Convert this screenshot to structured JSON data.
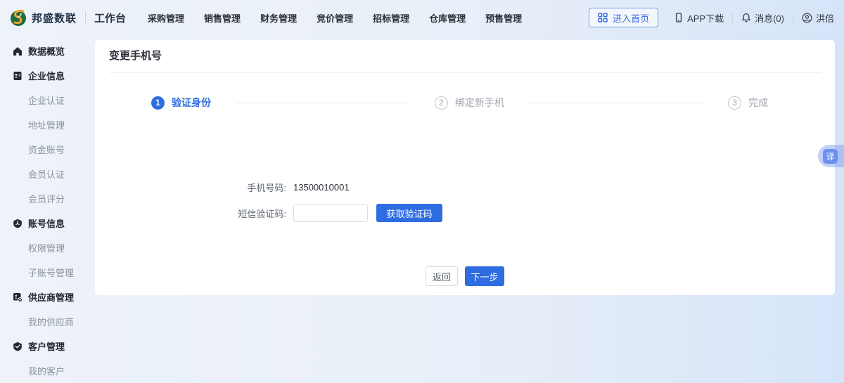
{
  "topbar": {
    "brand": "邦盛数联",
    "workspace": "工作台",
    "menu": [
      "采购管理",
      "销售管理",
      "财务管理",
      "竞价管理",
      "招标管理",
      "仓库管理",
      "预售管理"
    ],
    "enter_home": "进入首页",
    "app_download": "APP下载",
    "messages": "消息(0)",
    "username": "洪倍"
  },
  "sidebar": {
    "groups": [
      {
        "label": "数据概览",
        "icon": "home-icon",
        "children": []
      },
      {
        "label": "企业信息",
        "icon": "company-icon",
        "children": [
          "企业认证",
          "地址管理",
          "资金账号",
          "会员认证",
          "会员评分"
        ]
      },
      {
        "label": "账号信息",
        "icon": "account-icon",
        "children": [
          "权限管理",
          "子账号管理"
        ]
      },
      {
        "label": "供应商管理",
        "icon": "supplier-icon",
        "children": [
          "我的供应商"
        ]
      },
      {
        "label": "客户管理",
        "icon": "customer-icon",
        "children": [
          "我的客户"
        ]
      }
    ]
  },
  "main": {
    "title": "变更手机号",
    "steps": [
      {
        "num": "1",
        "label": "验证身份",
        "state": "active"
      },
      {
        "num": "2",
        "label": "绑定新手机",
        "state": "idle"
      },
      {
        "num": "3",
        "label": "完成",
        "state": "idle"
      }
    ],
    "form": {
      "phone_label": "手机号码:",
      "phone_value": "13500010001",
      "sms_label": "短信验证码:",
      "sms_value": "",
      "get_code_button": "获取验证码"
    },
    "back_button": "返回",
    "next_button": "下一步"
  },
  "floating": {
    "translate_label": "译"
  },
  "colors": {
    "accent": "#2e6ce2",
    "logo_green": "#1e6b3e",
    "logo_orange": "#f0a32f"
  }
}
